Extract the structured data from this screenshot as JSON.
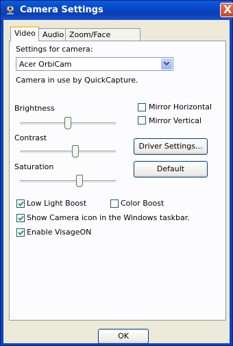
{
  "window": {
    "title": "Camera Settings",
    "close_glyph": "X"
  },
  "tabs": [
    {
      "label": "Video",
      "active": true
    },
    {
      "label": "Audio",
      "active": false
    },
    {
      "label": "Zoom/Face Tracking",
      "active": false
    }
  ],
  "camera": {
    "settings_label": "Settings for camera:",
    "selected": "Acer OrbiCam",
    "status": "Camera in use by QuickCapture."
  },
  "sliders": {
    "brightness": {
      "label": "Brightness",
      "value": 0.5
    },
    "contrast": {
      "label": "Contrast",
      "value": 0.58
    },
    "saturation": {
      "label": "Saturation",
      "value": 0.62
    }
  },
  "mirror": {
    "horizontal": {
      "label": "Mirror Horizontal",
      "checked": false
    },
    "vertical": {
      "label": "Mirror Vertical",
      "checked": false
    }
  },
  "buttons": {
    "driver_settings": "Driver Settings...",
    "default": "Default",
    "ok": "OK"
  },
  "options": {
    "low_light": {
      "label": "Low Light Boost",
      "checked": true
    },
    "color_boost": {
      "label": "Color Boost",
      "checked": false
    },
    "taskbar_icon": {
      "label": "Show Camera icon in the Windows taskbar.",
      "checked": true
    },
    "visageon": {
      "label": "Enable VisageON",
      "checked": true
    }
  },
  "colors": {
    "titlebar": "#0a4fd6",
    "check": "#21a121",
    "panel_border": "#919b9c"
  }
}
